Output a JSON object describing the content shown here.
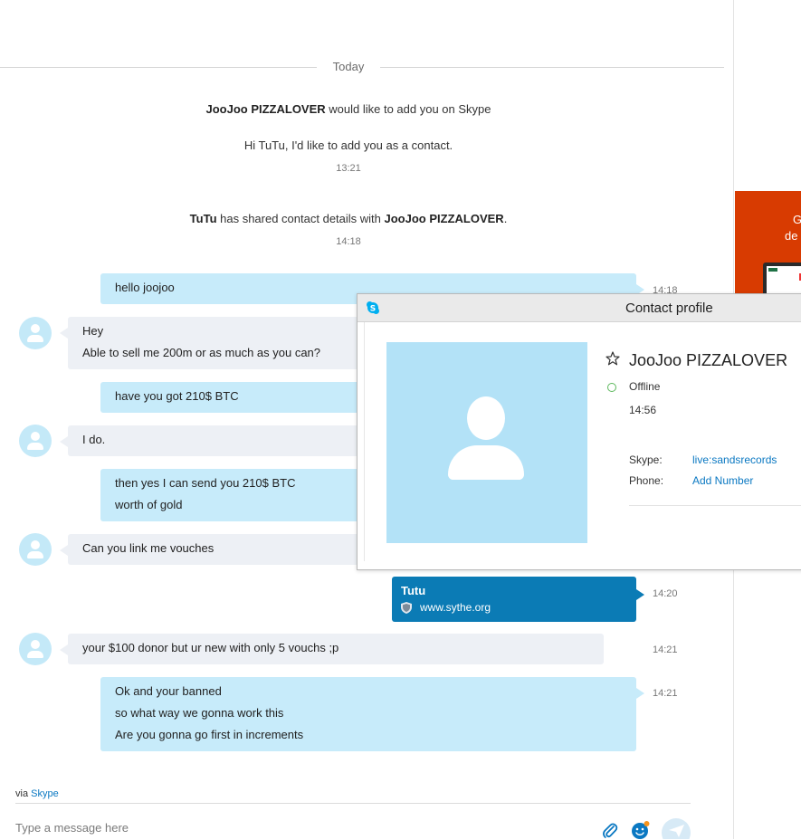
{
  "day_separator": "Today",
  "system_messages": [
    {
      "parts": [
        {
          "b": true,
          "t": "JooJoo PIZZALOVER"
        },
        {
          "b": false,
          "t": " would like to add you on Skype"
        }
      ]
    },
    {
      "parts": [
        {
          "b": false,
          "t": "Hi TuTu, I'd like to add you as a contact."
        }
      ],
      "time": "13:21"
    },
    {
      "parts": [
        {
          "b": true,
          "t": "TuTu"
        },
        {
          "b": false,
          "t": " has shared contact details with "
        },
        {
          "b": true,
          "t": "JooJoo PIZZALOVER"
        },
        {
          "b": false,
          "t": "."
        }
      ],
      "time": "14:18"
    }
  ],
  "messages": [
    {
      "dir": "out",
      "lines": [
        "hello joojoo"
      ],
      "time": "14:18"
    },
    {
      "dir": "in",
      "lines": [
        "Hey",
        "Able to sell me 200m or as much as you can?"
      ]
    },
    {
      "dir": "out",
      "lines": [
        "have you got 210$ BTC"
      ]
    },
    {
      "dir": "in",
      "lines": [
        "I do."
      ]
    },
    {
      "dir": "out",
      "lines": [
        "then yes I can send you 210$ BTC",
        "worth of gold"
      ]
    },
    {
      "dir": "in",
      "lines": [
        "Can you link me vouches"
      ]
    },
    {
      "dir": "in",
      "lines": [
        "your $100 donor but ur new with only 5 vouchs ;p"
      ],
      "time": "14:21"
    },
    {
      "dir": "out",
      "lines": [
        "Ok and your banned",
        "so what way we gonna work this",
        "Are you gonna go first in increments"
      ],
      "time": "14:21"
    }
  ],
  "link_card": {
    "title": "Tutu",
    "url": "www.sythe.org",
    "time": "14:20"
  },
  "footer": {
    "via_prefix": "via",
    "via_link": "Skype",
    "placeholder": "Type a message here"
  },
  "promo": {
    "line1": "G",
    "line2": "de"
  },
  "contact_popup": {
    "title": "Contact profile",
    "name": "JooJoo PIZZALOVER",
    "status": "Offline",
    "last_seen": "14:56",
    "skype_label": "Skype:",
    "skype_value": "live:sandsrecords",
    "phone_label": "Phone:",
    "phone_value": "Add Number"
  },
  "colors": {
    "outgoing": "#c7ebfa",
    "incoming": "#edf0f5",
    "link_card": "#0b7bb5",
    "accent": "#0a78c2",
    "promo": "#d83b01"
  },
  "icons": [
    "avatar-icon",
    "shield-icon",
    "paperclip-icon",
    "emoji-icon",
    "send-icon",
    "skype-logo-icon",
    "star-icon",
    "presence-offline-icon"
  ]
}
